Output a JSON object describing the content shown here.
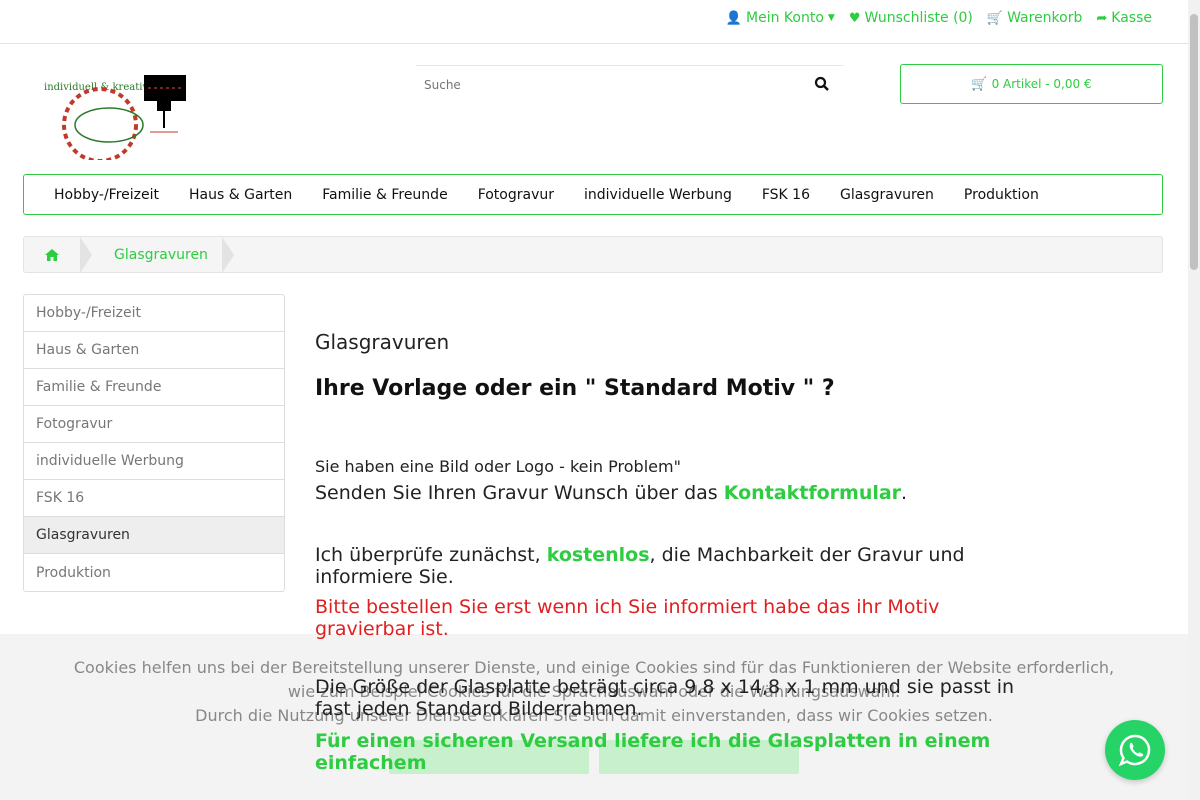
{
  "topnav": {
    "account": "Mein Konto",
    "wishlist": "Wunschliste (0)",
    "cart": "Warenkorb",
    "checkout": "Kasse"
  },
  "logo": {
    "text": "individuell & kreativ"
  },
  "search": {
    "placeholder": "Suche"
  },
  "cart_box": {
    "label": "0 Artikel - 0,00 €"
  },
  "mainnav": [
    "Hobby-/Freizeit",
    "Haus & Garten",
    "Familie & Freunde",
    "Fotogravur",
    "individuelle Werbung",
    "FSK 16",
    "Glasgravuren",
    "Produktion"
  ],
  "breadcrumb": {
    "current": "Glasgravuren"
  },
  "sidebar": {
    "items": [
      "Hobby-/Freizeit",
      "Haus & Garten",
      "Familie & Freunde",
      "Fotogravur",
      "individuelle Werbung",
      "FSK 16",
      "Glasgravuren",
      "Produktion"
    ],
    "active": "Glasgravuren"
  },
  "content": {
    "title": "Glasgravuren",
    "headline": "Ihre Vorlage oder ein \" Standard Motiv \" ?",
    "p1": "Sie haben eine Bild oder Logo - kein Problem\"",
    "p2_pre": "Senden Sie Ihren Gravur Wunsch über das ",
    "p2_link": "Kontaktformular",
    "p2_post": ".",
    "p3_pre": "Ich überprüfe zunächst, ",
    "p3_em": "kostenlos",
    "p3_post": ", die Machbarkeit der Gravur und informiere Sie.",
    "p_red": "Bitte bestellen Sie erst wenn ich Sie informiert habe das ihr Motiv gravierbar ist.",
    "p4": "Die Größe der Glasplatte beträgt circa 9,8 x 14,8 x 1 mm und sie passt in fast jeden Standard Bilderrahmen.",
    "p_green": "Für einen sicheren Versand liefere ich die Glasplatten in einem einfachem"
  },
  "cookie": {
    "line1": "Cookies helfen uns bei der Bereitstellung unserer Dienste, und einige Cookies sind für das Funktionieren der Website erforderlich,",
    "line2": "wie zum Beispiel Cookies für die Sprachauswahl oder die Währungsauswahl.",
    "line3": "Durch die Nutzung unserer Dienste erklären Sie sich damit einverstanden, dass wir Cookies setzen."
  },
  "colors": {
    "accent": "#2ecc40",
    "alert": "#e02020",
    "whatsapp": "#25d366"
  }
}
